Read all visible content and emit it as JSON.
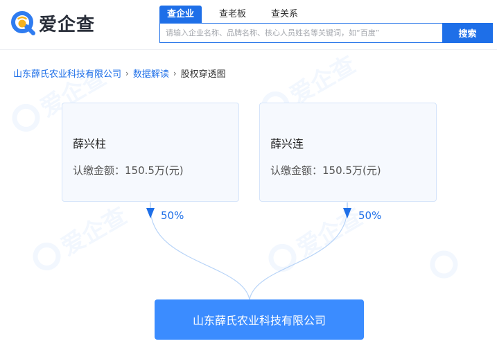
{
  "brand": {
    "name": "爱企查",
    "watermark": "爱企查"
  },
  "nav": {
    "tabs": [
      {
        "label": "查企业",
        "active": true
      },
      {
        "label": "查老板",
        "active": false
      },
      {
        "label": "查关系",
        "active": false
      }
    ]
  },
  "search": {
    "placeholder": "请输入企业名称、品牌名称、核心人员姓名等关键词，如“百度”",
    "button_label": "搜索"
  },
  "breadcrumb": {
    "company": "山东薛氏农业科技有限公司",
    "section": "数据解读",
    "current": "股权穿透图"
  },
  "shareholders": [
    {
      "name": "薛兴柱",
      "amount": "认缴金额：150.5万(元)",
      "percent": "50%"
    },
    {
      "name": "薛兴连",
      "amount": "认缴金额：150.5万(元)",
      "percent": "50%"
    }
  ],
  "company": {
    "name": "山东薛氏农业科技有限公司"
  },
  "colors": {
    "primary": "#1e6fe8",
    "company_box": "#3b8cff",
    "card_bg": "#f6f9fe",
    "card_border": "#d5e4fa"
  }
}
